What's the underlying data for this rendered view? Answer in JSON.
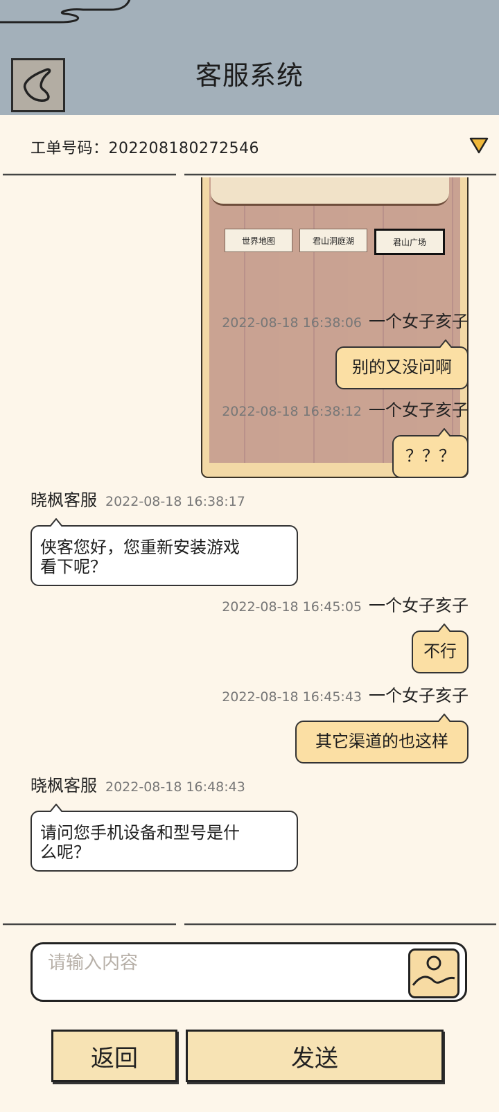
{
  "header": {
    "title": "客服系统"
  },
  "ticket": {
    "label": "工单号码：202208180272546"
  },
  "attachment": {
    "buttons": [
      "世界地图",
      "君山洞庭湖",
      "君山广场"
    ],
    "selected": "君山广场"
  },
  "messages": [
    {
      "sender": "一个女子亥子",
      "time": "2022-08-18 16:38:06",
      "text": "别的又没问啊"
    },
    {
      "sender": "一个女子亥子",
      "time": "2022-08-18 16:38:12",
      "text": "？？？"
    },
    {
      "sender": "晓枫客服",
      "time": "2022-08-18 16:38:17",
      "text_lines": [
        "侠客您好，您重新安装游戏",
        "看下呢？"
      ]
    },
    {
      "sender": "一个女子亥子",
      "time": "2022-08-18 16:45:05",
      "text": "不行"
    },
    {
      "sender": "一个女子亥子",
      "time": "2022-08-18 16:45:43",
      "text": "其它渠道的也这样"
    },
    {
      "sender": "晓枫客服",
      "time": "2022-08-18 16:48:43",
      "text_lines": [
        "请问您手机设备和型号是什",
        "么呢？"
      ]
    }
  ],
  "input": {
    "placeholder": "请输入内容",
    "value": ""
  },
  "actions": {
    "back_label": "返回",
    "send_label": "发送"
  },
  "icons": {
    "back": "back-arrow-icon",
    "dropdown": "triangle-down-icon",
    "image": "image-upload-icon"
  },
  "colors": {
    "header_bg": "#a3b0ba",
    "page_bg": "#fdf6ea",
    "user_bubble": "#fbdfa4",
    "agent_bubble": "#ffffff",
    "dropdown": "#f0b83a"
  }
}
